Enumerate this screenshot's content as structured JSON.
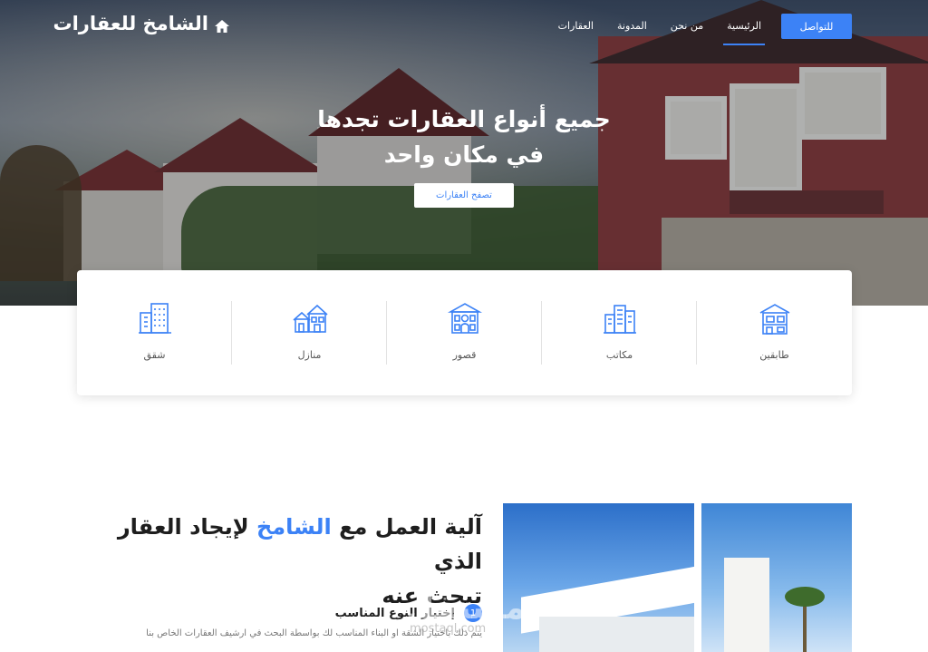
{
  "brand": {
    "name": "الشامخ للعقارات",
    "icon": "home-icon"
  },
  "nav": {
    "cta_label": "للتواصل",
    "links": [
      {
        "label": "الرئيسية",
        "active": true
      },
      {
        "label": "من نحن",
        "active": false
      },
      {
        "label": "المدونة",
        "active": false
      },
      {
        "label": "العقارات",
        "active": false
      }
    ]
  },
  "hero": {
    "title_line1": "جميع أنواع العقارات تجدها",
    "title_line2": "في مكان واحد",
    "browse_label": "تصفح العقارات"
  },
  "categories": [
    {
      "label": "طابقين",
      "icon": "duplex-house-icon"
    },
    {
      "label": "مكاتب",
      "icon": "office-buildings-icon"
    },
    {
      "label": "قصور",
      "icon": "palace-icon"
    },
    {
      "label": "منازل",
      "icon": "houses-icon"
    },
    {
      "label": "شقق",
      "icon": "apartments-icon"
    }
  ],
  "how_it_works": {
    "title_before": "آلية العمل مع",
    "title_accent": "الشامخ",
    "title_after": "لإيجاد العقار الذي",
    "title_line2": "تبحث عنه",
    "step_number": "1",
    "step_title": "إختيار النوع المناسب",
    "step_desc": "يتم ذلك باختيار الشقة او البناء المناسب لك بواسطة البحث في ارشيف العقارات الخاص بنا"
  },
  "watermark": {
    "text": "مستقل",
    "sub": "mostaql.com"
  },
  "colors": {
    "accent": "#3c82f6",
    "hero_overlay": "#1f2a3a"
  }
}
